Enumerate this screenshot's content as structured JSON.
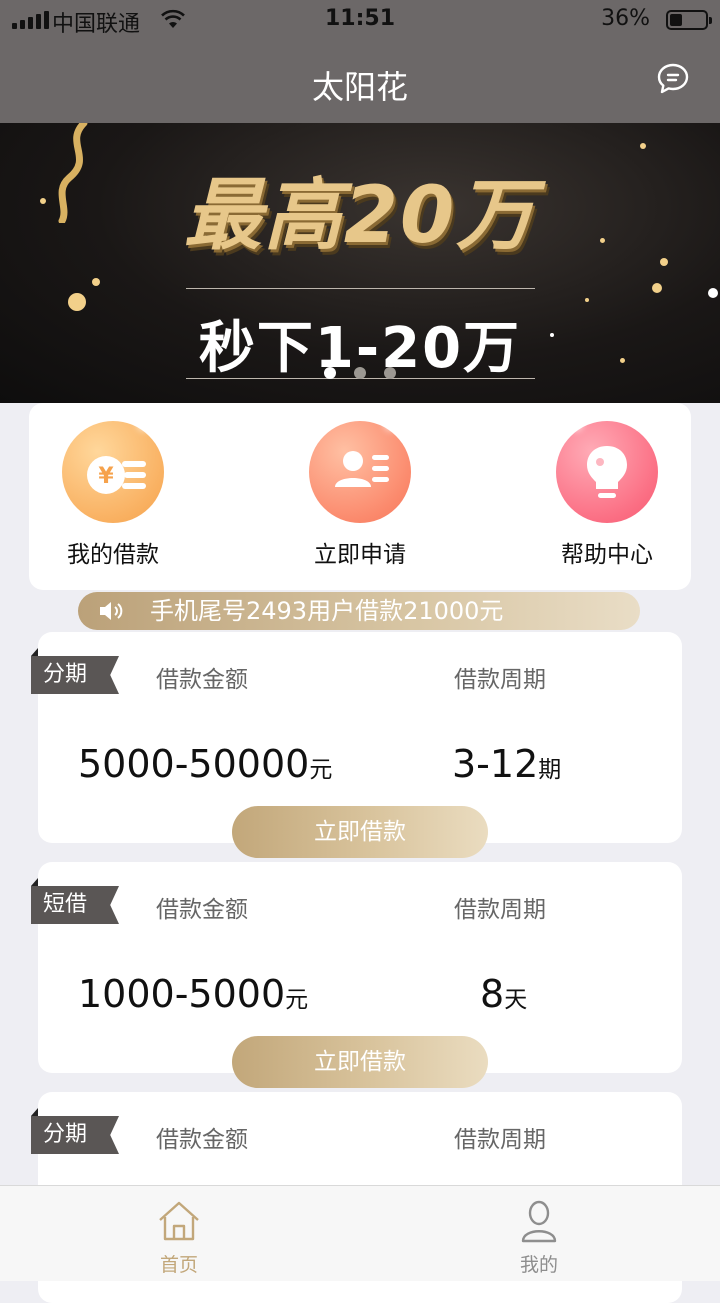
{
  "status_bar": {
    "carrier": "中国联通",
    "time": "11:51",
    "battery_percent": "36%",
    "battery_level": 0.36
  },
  "nav": {
    "title": "太阳花",
    "message_icon": "chat-bubble-icon"
  },
  "banner": {
    "headline": "最高20万",
    "subline": "秒下1-20万",
    "slide_count": 3,
    "active_slide": 0
  },
  "quick_menu": [
    {
      "label": "我的借款",
      "icon": "coin-stack-icon",
      "color": "#f9b162"
    },
    {
      "label": "立即申请",
      "icon": "id-card-icon",
      "color": "#fb8a6d"
    },
    {
      "label": "帮助中心",
      "icon": "light-bulb-icon",
      "color": "#fb6f84"
    }
  ],
  "notice": {
    "text": "手机尾号2493用户借款21000元",
    "icon": "speaker-icon"
  },
  "products": [
    {
      "tag": "分期",
      "amount_label": "借款金额",
      "period_label": "借款周期",
      "amount": "5000-50000",
      "amount_unit": "元",
      "period": "3-12",
      "period_unit": "期",
      "button": "立即借款"
    },
    {
      "tag": "短借",
      "amount_label": "借款金额",
      "period_label": "借款周期",
      "amount": "1000-5000",
      "amount_unit": "元",
      "period": "8",
      "period_unit": "天",
      "button": "立即借款"
    },
    {
      "tag": "分期",
      "amount_label": "借款金额",
      "period_label": "借款周期"
    }
  ],
  "tabbar": [
    {
      "label": "首页",
      "icon": "home-icon",
      "active": true
    },
    {
      "label": "我的",
      "icon": "user-icon",
      "active": false
    }
  ],
  "colors": {
    "header_bg": "#6c6868",
    "accent_gold": "#c2a77a",
    "tag_bg": "#5a5655",
    "tab_active": "#c2a77a",
    "tab_inactive": "#8e8e8e"
  }
}
